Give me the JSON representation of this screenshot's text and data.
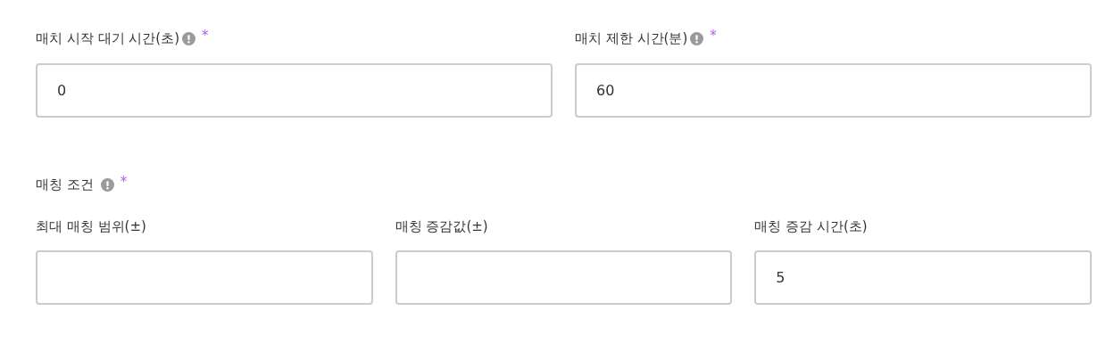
{
  "top_fields": [
    {
      "label": "매치 시작 대기 시간(초)",
      "info": true,
      "required_mark": "*",
      "value": "0"
    },
    {
      "label": "매치 제한 시간(분)",
      "info": true,
      "required_mark": "*",
      "value": "60"
    }
  ],
  "matching_conditions": {
    "label": "매칭 조건",
    "info": true,
    "required_mark": "*",
    "fields": [
      {
        "label": "최대 매칭 범위(±)"
      },
      {
        "label": "매칭 증감값(±)"
      },
      {
        "label": "매칭 증감 시간(초)",
        "value": "5"
      }
    ]
  }
}
